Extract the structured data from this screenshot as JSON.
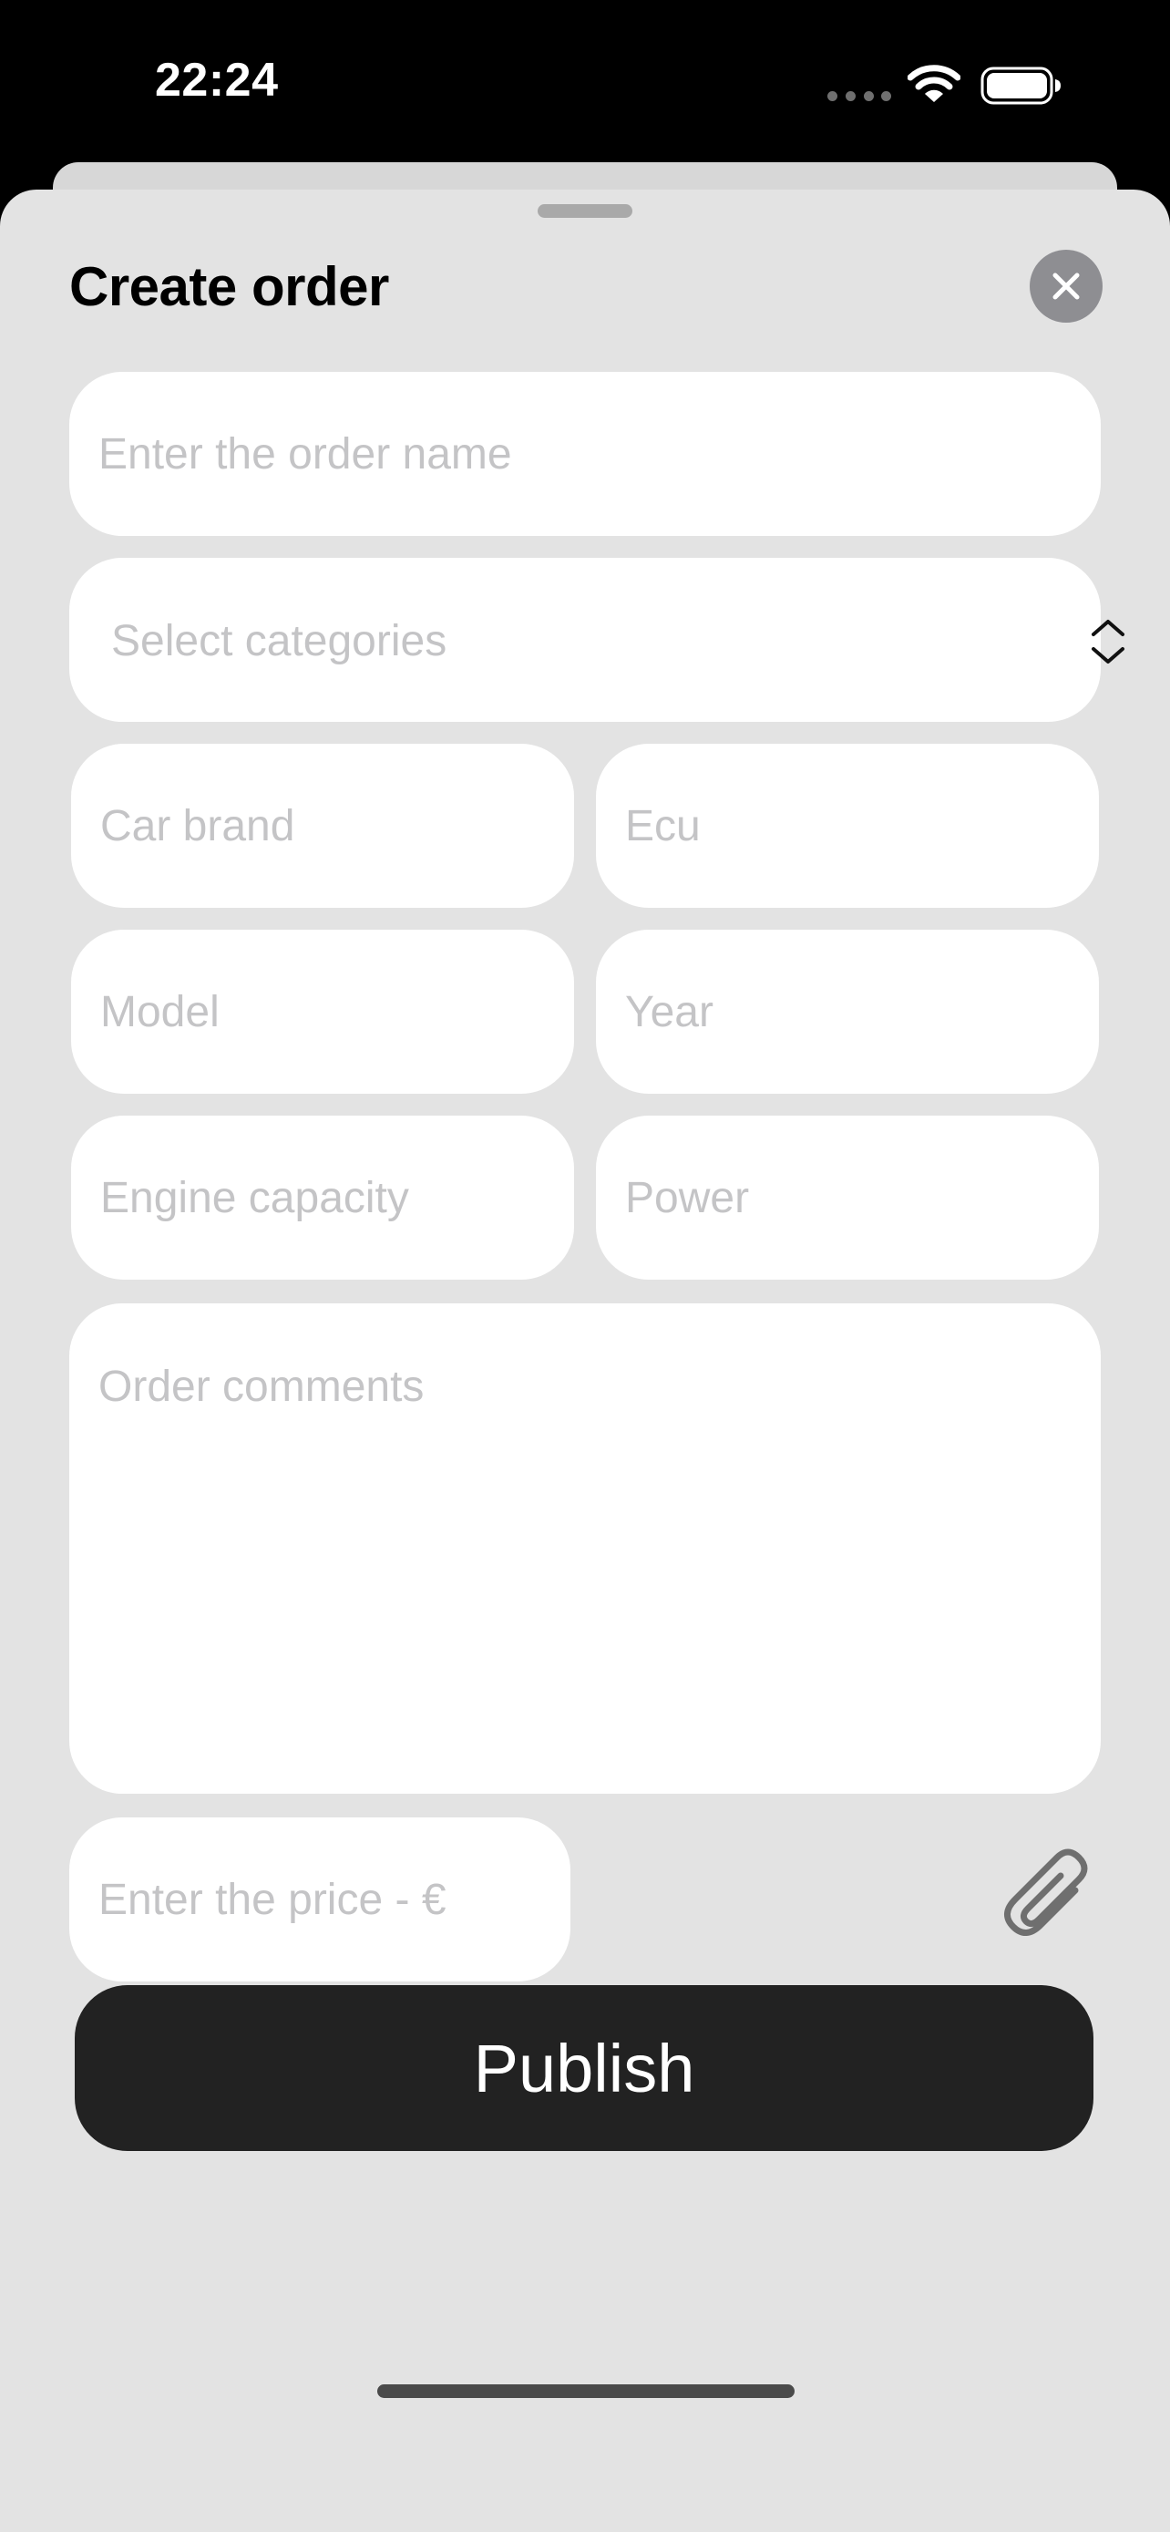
{
  "status_bar": {
    "time": "22:24",
    "cellular_icon": "cellular-dots-icon",
    "wifi_icon": "wifi-icon",
    "battery_icon": "battery-icon"
  },
  "sheet": {
    "title": "Create order",
    "close_icon": "close-icon"
  },
  "form": {
    "order_name": {
      "placeholder": "Enter the order name",
      "value": ""
    },
    "categories": {
      "placeholder": "Select categories",
      "icon": "chevron-up-down-icon"
    },
    "car_brand": {
      "placeholder": "Car brand",
      "value": ""
    },
    "ecu": {
      "placeholder": "Ecu",
      "value": ""
    },
    "model": {
      "placeholder": "Model",
      "value": ""
    },
    "year": {
      "placeholder": "Year",
      "value": ""
    },
    "engine_capacity": {
      "placeholder": "Engine capacity",
      "value": ""
    },
    "power": {
      "placeholder": "Power",
      "value": ""
    },
    "comments": {
      "placeholder": "Order comments",
      "value": ""
    },
    "price": {
      "placeholder": "Enter the price - €",
      "value": ""
    },
    "attach_icon": "paperclip-icon"
  },
  "actions": {
    "publish_label": "Publish"
  },
  "colors": {
    "sheet_background": "#e3e3e3",
    "field_background": "#ffffff",
    "placeholder": "#c4c4c6",
    "primary_button": "#222222",
    "close_button": "#8e8e92"
  }
}
